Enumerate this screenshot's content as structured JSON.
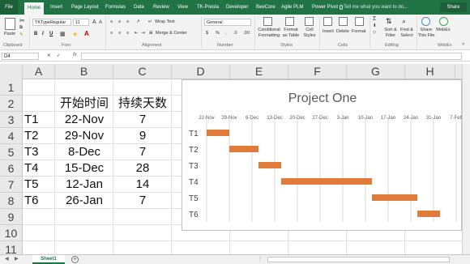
{
  "ribbon_tabs": [
    "File",
    "Home",
    "Insert",
    "Page Layout",
    "Formulas",
    "Data",
    "Review",
    "View",
    "TK-Presta",
    "Developer",
    "BeeCore",
    "Agile PLM",
    "Power Pivot"
  ],
  "tell_me": "Tell me what you want to do...",
  "share_label": "Share",
  "ribbon": {
    "clipboard": {
      "group": "Clipboard",
      "paste": "Paste"
    },
    "font": {
      "group": "Font",
      "name": "TKTypeRegular",
      "size": "11",
      "bold": "B",
      "italic": "I",
      "underline": "U"
    },
    "alignment": {
      "group": "Alignment",
      "wrap_text": "Wrap Text",
      "merge_center": "Merge & Center"
    },
    "number": {
      "group": "Number",
      "format": "General",
      "currency": "$",
      "percent": "%",
      "comma": ","
    },
    "styles": {
      "group": "Styles",
      "conditional": "Conditional Formatting",
      "format_table": "Format as Table",
      "cell_styles": "Cell Styles"
    },
    "cells": {
      "group": "Cells",
      "insert": "Insert",
      "delete": "Delete",
      "format": "Format"
    },
    "editing": {
      "group": "Editing",
      "sort": "Sort & Filter",
      "find": "Find & Select",
      "sigma": "Σ"
    },
    "share_file": {
      "label": "Share This File"
    },
    "webex": {
      "group": "WebEx",
      "label": "WebEx"
    }
  },
  "name_box": "D4",
  "fx": "fx",
  "columns": [
    "A",
    "B",
    "C",
    "D",
    "E",
    "F",
    "G",
    "H"
  ],
  "rows": [
    "1",
    "2",
    "3",
    "4",
    "5",
    "6",
    "7",
    "8",
    "9",
    "10",
    "11"
  ],
  "table": {
    "header_start": "开始时间",
    "header_duration": "持续天数",
    "tasks": [
      {
        "name": "T1",
        "start": "22-Nov",
        "days": "7"
      },
      {
        "name": "T2",
        "start": "29-Nov",
        "days": "9"
      },
      {
        "name": "T3",
        "start": "8-Dec",
        "days": "7"
      },
      {
        "name": "T4",
        "start": "15-Dec",
        "days": "28"
      },
      {
        "name": "T5",
        "start": "12-Jan",
        "days": "14"
      },
      {
        "name": "T6",
        "start": "26-Jan",
        "days": "7"
      }
    ]
  },
  "chart_data": {
    "type": "bar",
    "orientation": "horizontal-gantt",
    "title": "Project One",
    "x_ticks": [
      "22-Nov",
      "29-Nov",
      "6-Dec",
      "13-Dec",
      "20-Dec",
      "27-Dec",
      "3-Jan",
      "10-Jan",
      "17-Jan",
      "24-Jan",
      "31-Jan",
      "7-Feb"
    ],
    "x_axis_position": "top",
    "categories": [
      "T1",
      "T2",
      "T3",
      "T4",
      "T5",
      "T6"
    ],
    "start_day_index": [
      0,
      7,
      16,
      23,
      51,
      65
    ],
    "duration_days": [
      7,
      9,
      7,
      28,
      14,
      7
    ],
    "xlim_days": [
      0,
      77
    ],
    "bar_color": "#e07b39",
    "grid": true
  },
  "sheet_tab": "Sheet1",
  "add_sheet": "+"
}
